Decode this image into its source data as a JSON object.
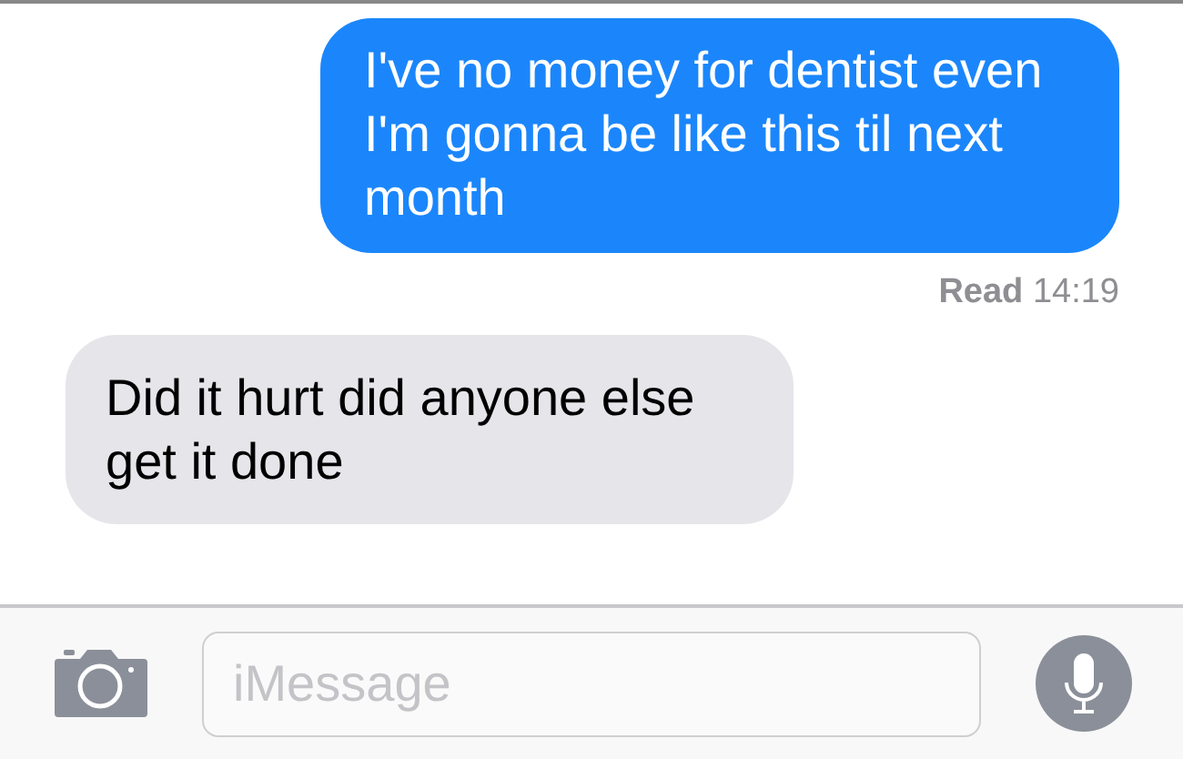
{
  "messages": [
    {
      "kind": "sent",
      "text": "I've no money for dentist even I'm gonna be like this til next month"
    },
    {
      "kind": "receipt",
      "text": "**Read** 14:19"
    },
    {
      "kind": "received",
      "text": "Did it hurt  did anyone else get it done"
    }
  ],
  "composer": {
    "placeholder": "iMessage"
  }
}
